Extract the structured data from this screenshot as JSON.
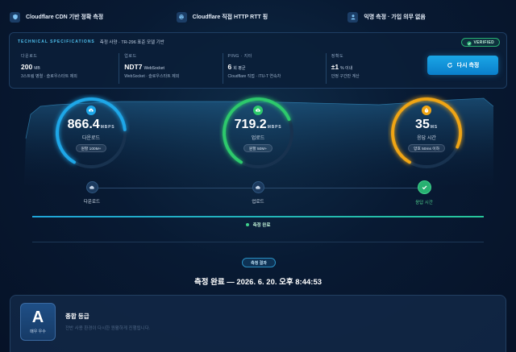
{
  "features": [
    {
      "label": "Cloudflare CDN 기반 정확 측정",
      "icon": "shield-icon"
    },
    {
      "label": "Cloudflare 직접 HTTP RTT 핑",
      "icon": "globe-icon"
    },
    {
      "label": "익명 측정 · 가입 의무 없음",
      "icon": "user-icon"
    }
  ],
  "spec": {
    "tag": "TECHNICAL SPECIFICATIONS",
    "subtitle": "측정 사양 · TR-296 표준 모델 기반",
    "verified": "VERIFIED",
    "columns": [
      {
        "label": "다운로드",
        "value": "200",
        "unit": "MB",
        "sub": "3스트림 병렬 · 슬로우스타트 제외"
      },
      {
        "label": "업로드",
        "value": "NDT7",
        "unit": "WebSocket",
        "sub": "WebSocket · 슬로우스타트 제외"
      },
      {
        "label": "PING · 지터",
        "value": "6",
        "unit": "회 평균",
        "sub": "Cloudflare 직접 · ITU-T 연속차"
      },
      {
        "label": "정확도",
        "value": "±1",
        "unit": "% 이내",
        "sub": "안정 구간만 계산"
      }
    ],
    "retest_label": "다시 측정"
  },
  "gauges": [
    {
      "value": "866.4",
      "unit": "MBPS",
      "label": "다운로드",
      "pill": "원할 100M+",
      "color": "#1ea7e8",
      "fill": 0.78
    },
    {
      "value": "719.2",
      "unit": "MBPS",
      "label": "업로드",
      "pill": "원할 50M+",
      "color": "#2dc96c",
      "fill": 0.72
    },
    {
      "value": "35",
      "unit": "MS",
      "label": "응답 시간",
      "pill": "양호 50ms 이하",
      "color": "#f0a514",
      "fill": 0.88
    }
  ],
  "steps": [
    {
      "label": "다운로드",
      "done": false
    },
    {
      "label": "업로드",
      "done": false
    },
    {
      "label": "응답 시간",
      "done": true
    }
  ],
  "status": "측정 완료",
  "result": {
    "pill": "측정 결과",
    "title": "측정 완료 — 2026. 6. 20. 오후 8:44:53"
  },
  "grade": {
    "letter": "A",
    "word": "매우 우수",
    "title": "종합 등급",
    "desc": "전반 사용 환경이 다시한 원활하게 진행됩니다."
  },
  "colors": {
    "accent": "#1ea7e8",
    "ok": "#2dc96c",
    "warn": "#f0a514",
    "bg": "#061327"
  }
}
